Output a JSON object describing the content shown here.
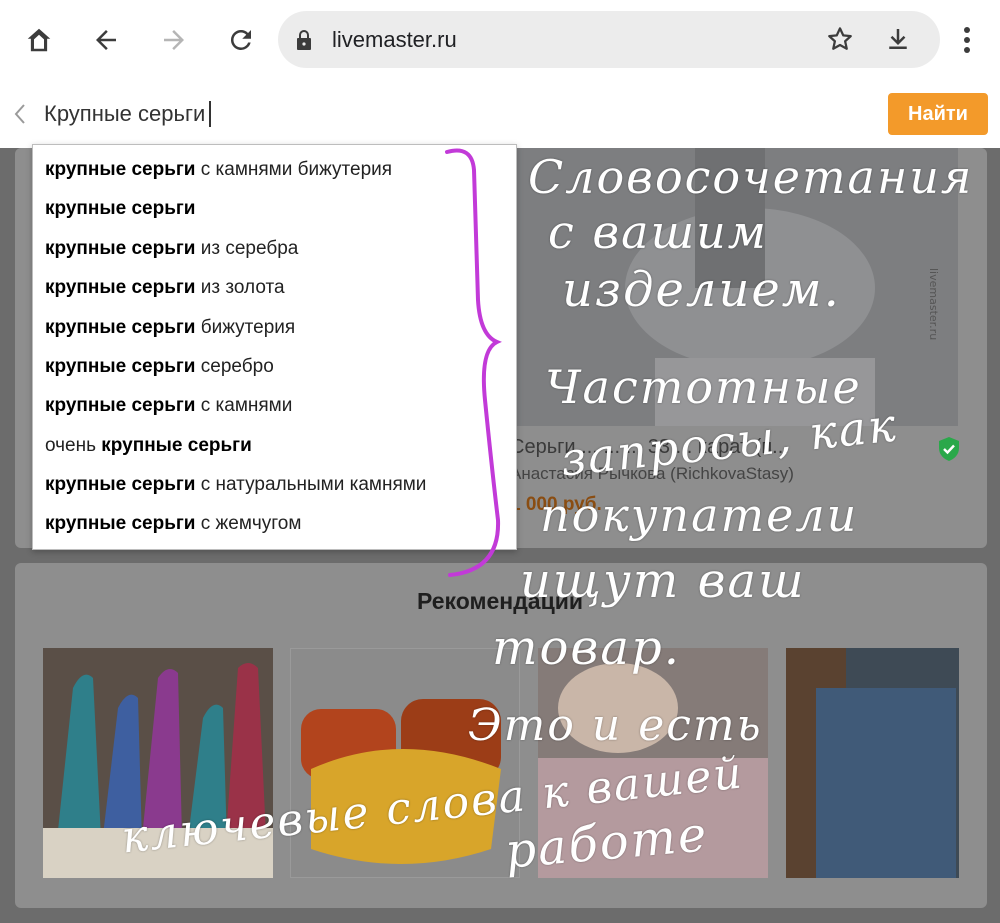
{
  "browser": {
    "url": "livemaster.ru",
    "icons": [
      "home-icon",
      "back-arrow-icon",
      "forward-arrow-icon",
      "reload-icon",
      "lock-icon",
      "star-icon",
      "download-icon",
      "more-vert-icon"
    ]
  },
  "search": {
    "query": "Крупные серьги",
    "submit_label": "Найти"
  },
  "suggestions": [
    {
      "before": "",
      "bold": "крупные серьги",
      "after": " с камнями бижутерия"
    },
    {
      "before": "",
      "bold": "крупные серьги",
      "after": ""
    },
    {
      "before": "",
      "bold": "крупные серьги",
      "after": " из серебра"
    },
    {
      "before": "",
      "bold": "крупные серьги",
      "after": " из золота"
    },
    {
      "before": "",
      "bold": "крупные серьги",
      "after": " бижутерия"
    },
    {
      "before": "",
      "bold": "крупные серьги",
      "after": " серебро"
    },
    {
      "before": "",
      "bold": "крупные серьги",
      "after": " с камнями"
    },
    {
      "before": "очень ",
      "bold": "крупные серьги",
      "after": ""
    },
    {
      "before": "",
      "bold": "крупные серьги",
      "after": " с натуральными камнями"
    },
    {
      "before": "",
      "bold": "крупные серьги",
      "after": " с жемчугом"
    }
  ],
  "product": {
    "title": "Серьги ... ... ... 33 ... карат (п...",
    "author": "Анастасия Рычкова (RichkovaStasy)",
    "price": "1 000 руб.",
    "watermark": "livemaster.ru"
  },
  "recommendations": {
    "title": "Рекомендации"
  },
  "annotation": {
    "lines": [
      "Словосочетания",
      "с вашим",
      "изделием.",
      "Частотные",
      "запросы, как",
      "покупатели",
      "ищут ваш",
      "товар.",
      "Это и есть",
      "ключевые слова к вашей",
      "работе"
    ],
    "color": "#ffffff",
    "bracket_color": "#c23ad8"
  }
}
